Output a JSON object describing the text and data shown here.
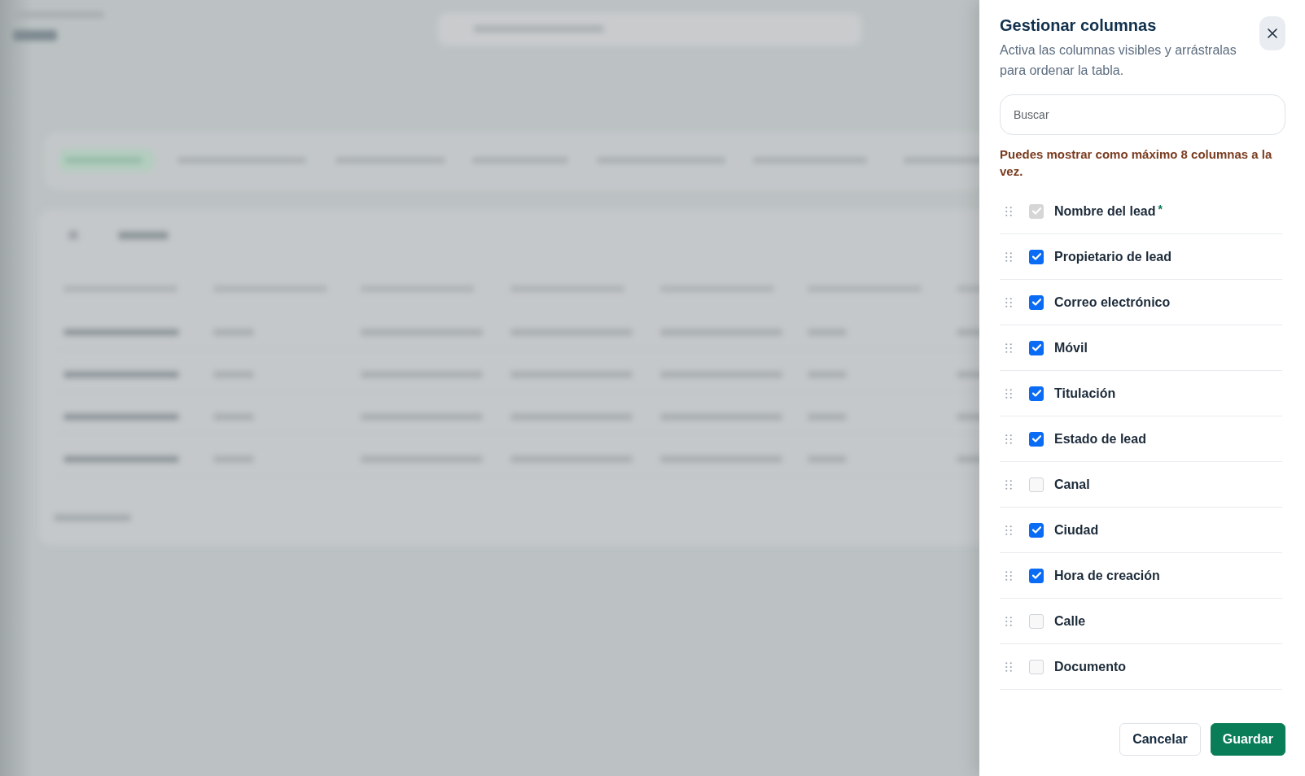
{
  "drawer": {
    "title": "Gestionar columnas",
    "description": "Activa las columnas visibles y arrástralas para ordenar la tabla."
  },
  "search": {
    "placeholder": "Buscar"
  },
  "limit_notice": "Puedes mostrar como máximo 8 columnas a la vez.",
  "columns": [
    {
      "label": "Nombre del lead",
      "required_mark": "*",
      "checked": true,
      "disabled": true
    },
    {
      "label": "Propietario de lead",
      "checked": true,
      "disabled": false
    },
    {
      "label": "Correo electrónico",
      "checked": true,
      "disabled": false
    },
    {
      "label": "Móvil",
      "checked": true,
      "disabled": false
    },
    {
      "label": "Titulación",
      "checked": true,
      "disabled": false
    },
    {
      "label": "Estado de lead",
      "checked": true,
      "disabled": false
    },
    {
      "label": "Canal",
      "checked": false,
      "disabled": false
    },
    {
      "label": "Ciudad",
      "checked": true,
      "disabled": false
    },
    {
      "label": "Hora de creación",
      "checked": true,
      "disabled": false
    },
    {
      "label": "Calle",
      "checked": false,
      "disabled": false
    },
    {
      "label": "Documento",
      "checked": false,
      "disabled": false
    }
  ],
  "buttons": [
    {
      "label": "Cancelar",
      "kind": "secondary"
    },
    {
      "label": "Guardar",
      "kind": "primary"
    }
  ]
}
